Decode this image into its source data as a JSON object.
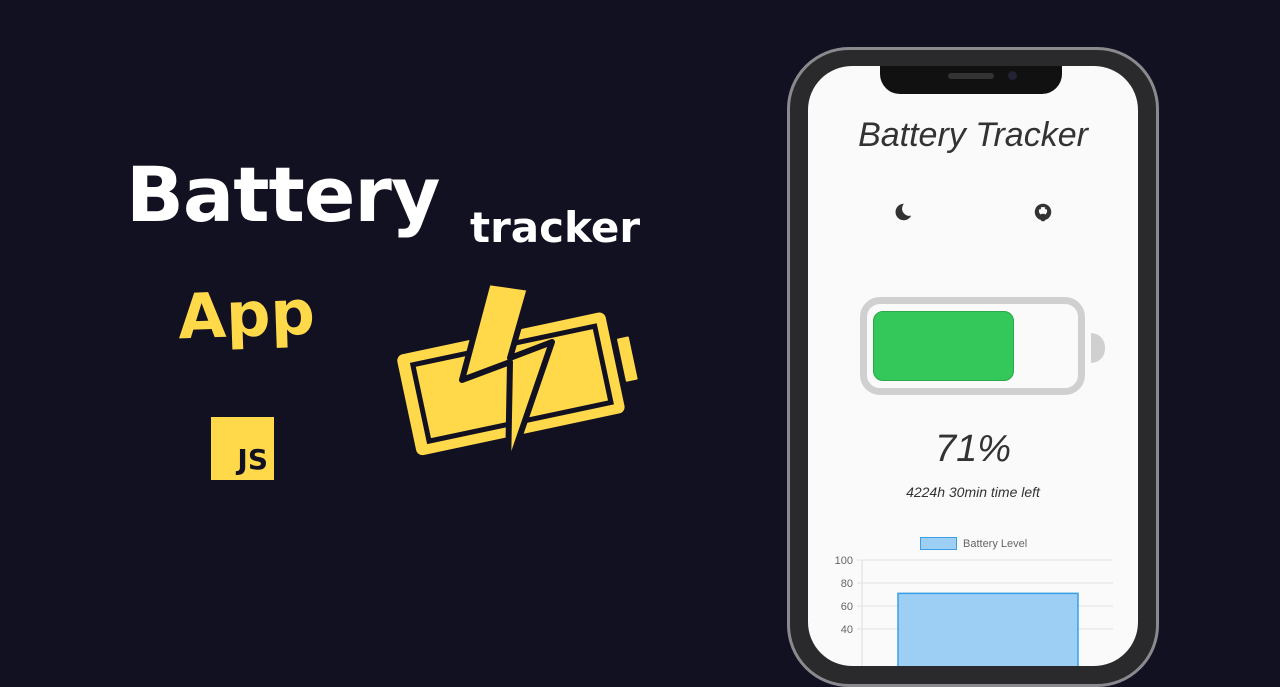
{
  "hero": {
    "title": "Battery",
    "subtitle": "tracker",
    "app": "App",
    "js_logo": "JS"
  },
  "phone": {
    "app_title": "Battery Tracker",
    "icons": [
      "moon-icon",
      "github-icon"
    ],
    "battery_level_percent": 71,
    "battery_fill_color": "#34c759",
    "percent_label": "71%",
    "time_left": "4224h 30min time left"
  },
  "chart_data": {
    "type": "bar",
    "categories": [
      ""
    ],
    "series": [
      {
        "name": "Battery Level",
        "values": [
          71
        ]
      }
    ],
    "legend": "Battery Level",
    "yticks": [
      "100",
      "80",
      "60",
      "40"
    ],
    "ylim": [
      0,
      100
    ],
    "grid": true,
    "legend_position": "top"
  }
}
